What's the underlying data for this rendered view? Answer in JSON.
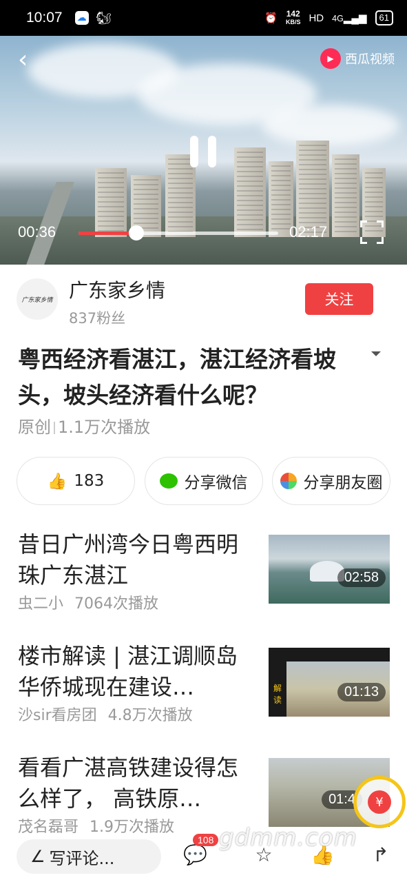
{
  "status_bar": {
    "time": "10:07",
    "speed": "142",
    "speed_unit": "KB/S",
    "hd": "HD",
    "network": "4G",
    "battery": "61"
  },
  "player": {
    "app_name": "西瓜视频",
    "current_time": "00:36",
    "duration": "02:17",
    "progress": 0.29
  },
  "author": {
    "avatar_text": "广东家乡情",
    "name": "广东家乡情",
    "fans": "837粉丝",
    "follow_label": "关注"
  },
  "video": {
    "title": "粤西经济看湛江，湛江经济看坡头，坡头经济看什么呢？",
    "original": "原创",
    "plays": "1.1万次播放"
  },
  "actions": {
    "likes": "183",
    "share_wechat": "分享微信",
    "share_moments": "分享朋友圈"
  },
  "related": [
    {
      "title": "昔日广州湾今日粤西明珠广东湛江",
      "author": "虫二小",
      "plays": "7064次播放",
      "duration": "02:58"
    },
    {
      "title": "楼市解读 | 湛江调顺岛华侨城现在建设…",
      "author": "沙sir看房团",
      "plays": "4.8万次播放",
      "duration": "01:13"
    },
    {
      "title": "看看广湛高铁建设得怎么样了， 高铁原…",
      "author": "茂名磊哥",
      "plays": "1.9万次播放",
      "duration": "01:4"
    }
  ],
  "bottom_bar": {
    "comment_placeholder": "写评论...",
    "comment_count": "108",
    "reward_symbol": "¥",
    "watermark": "gdmm.com"
  },
  "colors": {
    "accent": "#f04142",
    "reward_ring": "#f5c518"
  }
}
